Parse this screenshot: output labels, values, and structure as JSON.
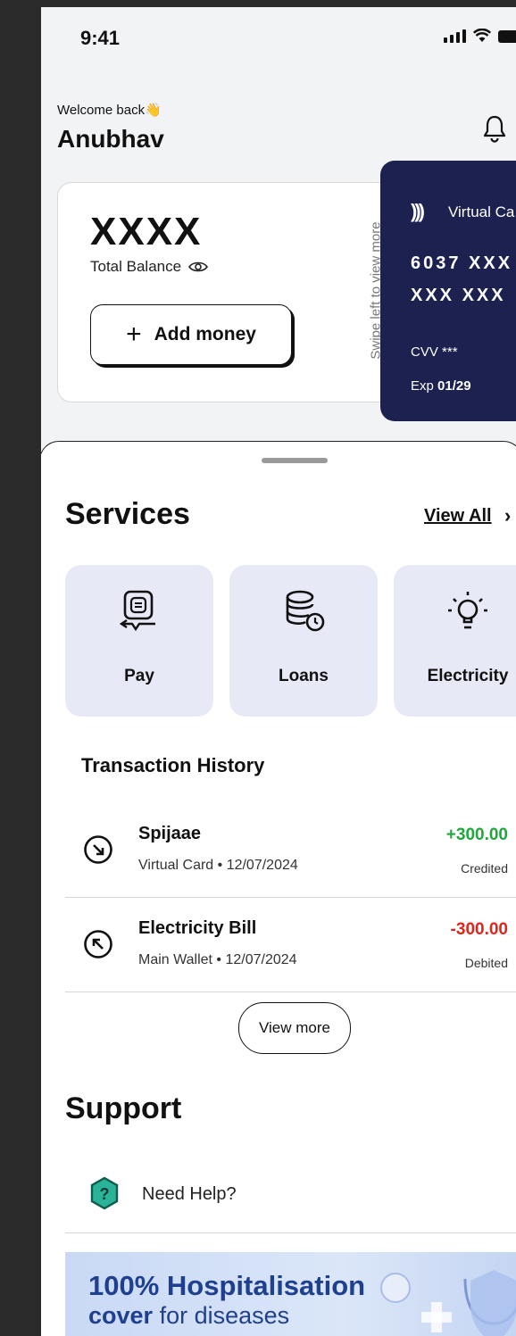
{
  "status_bar": {
    "time": "9:41"
  },
  "header": {
    "welcome": "Welcome back👋",
    "user_name": "Anubhav"
  },
  "balance": {
    "amount": "XXXX",
    "label": "Total Balance",
    "add_money_label": "Add money",
    "swipe_hint": "Swipe left to view more"
  },
  "virtual_card": {
    "title": "Virtual Ca",
    "number_line1": "6037 XXX",
    "number_line2": "XXX XXX",
    "cvv_label": "CVV",
    "cvv_value": "***",
    "exp_label": "Exp",
    "exp_value": "01/29",
    "color": "#1d2150"
  },
  "services": {
    "title": "Services",
    "view_all": "View All",
    "items": [
      {
        "label": "Pay",
        "icon": "receipt-payment-icon"
      },
      {
        "label": "Loans",
        "icon": "coins-clock-icon"
      },
      {
        "label": "Electricity",
        "icon": "lightbulb-icon"
      }
    ]
  },
  "transactions": {
    "title": "Transaction History",
    "items": [
      {
        "name": "Spijaae",
        "source": "Virtual Card",
        "date": "12/07/2024",
        "amount": "+300.00",
        "status": "Credited",
        "type": "credit"
      },
      {
        "name": "Electricity Bill",
        "source": "Main Wallet",
        "date": "12/07/2024",
        "amount": "-300.00",
        "status": "Debited",
        "type": "debit"
      }
    ],
    "view_more": "View more"
  },
  "support": {
    "title": "Support",
    "help": "Need Help?"
  },
  "banner": {
    "line1": "100% Hospitalisation",
    "line2_bold": "cover",
    "line2_rest": " for diseases"
  },
  "colors": {
    "credit": "#1fa83a",
    "debit": "#e0261b",
    "service_bg": "#e8e9f7",
    "banner_text": "#1f3f8f"
  }
}
